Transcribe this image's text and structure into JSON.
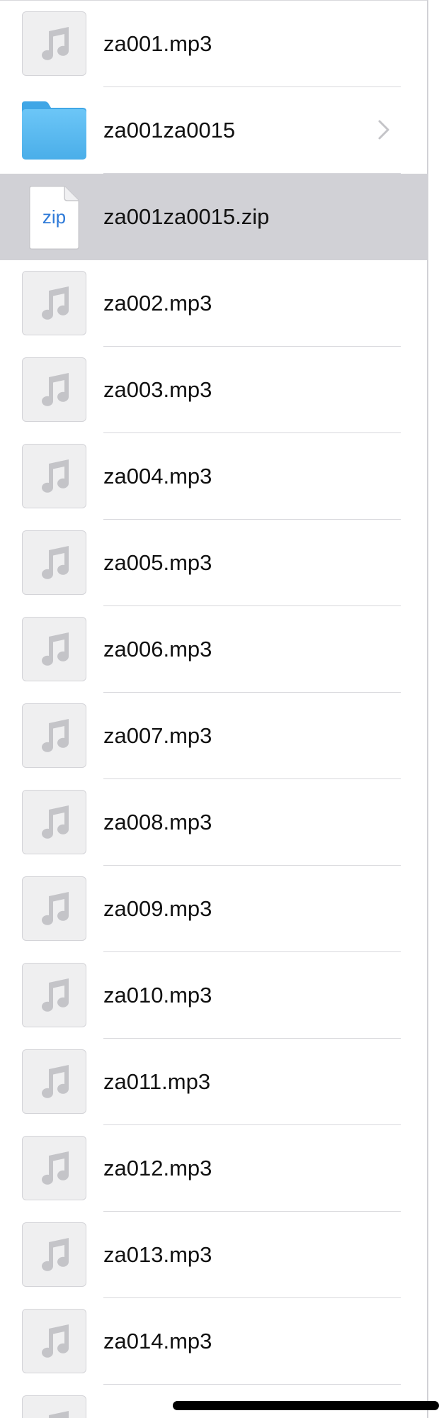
{
  "items": [
    {
      "name": "za001.mp3",
      "icon": "music-note-icon",
      "kind": "audio"
    },
    {
      "name": "za001za0015",
      "icon": "folder-icon",
      "kind": "folder"
    },
    {
      "name": "za001za0015.zip",
      "icon": "zip-file-icon",
      "kind": "zip",
      "thumb_label": "zip",
      "selected": true
    },
    {
      "name": "za002.mp3",
      "icon": "music-note-icon",
      "kind": "audio"
    },
    {
      "name": "za003.mp3",
      "icon": "music-note-icon",
      "kind": "audio"
    },
    {
      "name": "za004.mp3",
      "icon": "music-note-icon",
      "kind": "audio"
    },
    {
      "name": "za005.mp3",
      "icon": "music-note-icon",
      "kind": "audio"
    },
    {
      "name": "za006.mp3",
      "icon": "music-note-icon",
      "kind": "audio"
    },
    {
      "name": "za007.mp3",
      "icon": "music-note-icon",
      "kind": "audio"
    },
    {
      "name": "za008.mp3",
      "icon": "music-note-icon",
      "kind": "audio"
    },
    {
      "name": "za009.mp3",
      "icon": "music-note-icon",
      "kind": "audio"
    },
    {
      "name": "za010.mp3",
      "icon": "music-note-icon",
      "kind": "audio"
    },
    {
      "name": "za011.mp3",
      "icon": "music-note-icon",
      "kind": "audio"
    },
    {
      "name": "za012.mp3",
      "icon": "music-note-icon",
      "kind": "audio"
    },
    {
      "name": "za013.mp3",
      "icon": "music-note-icon",
      "kind": "audio"
    },
    {
      "name": "za014.mp3",
      "icon": "music-note-icon",
      "kind": "audio"
    }
  ],
  "colors": {
    "selected_row": "#d1d1d6",
    "folder": "#5ab8f2",
    "zip_text": "#2e7ad8",
    "music_note": "#c4c4c8"
  }
}
